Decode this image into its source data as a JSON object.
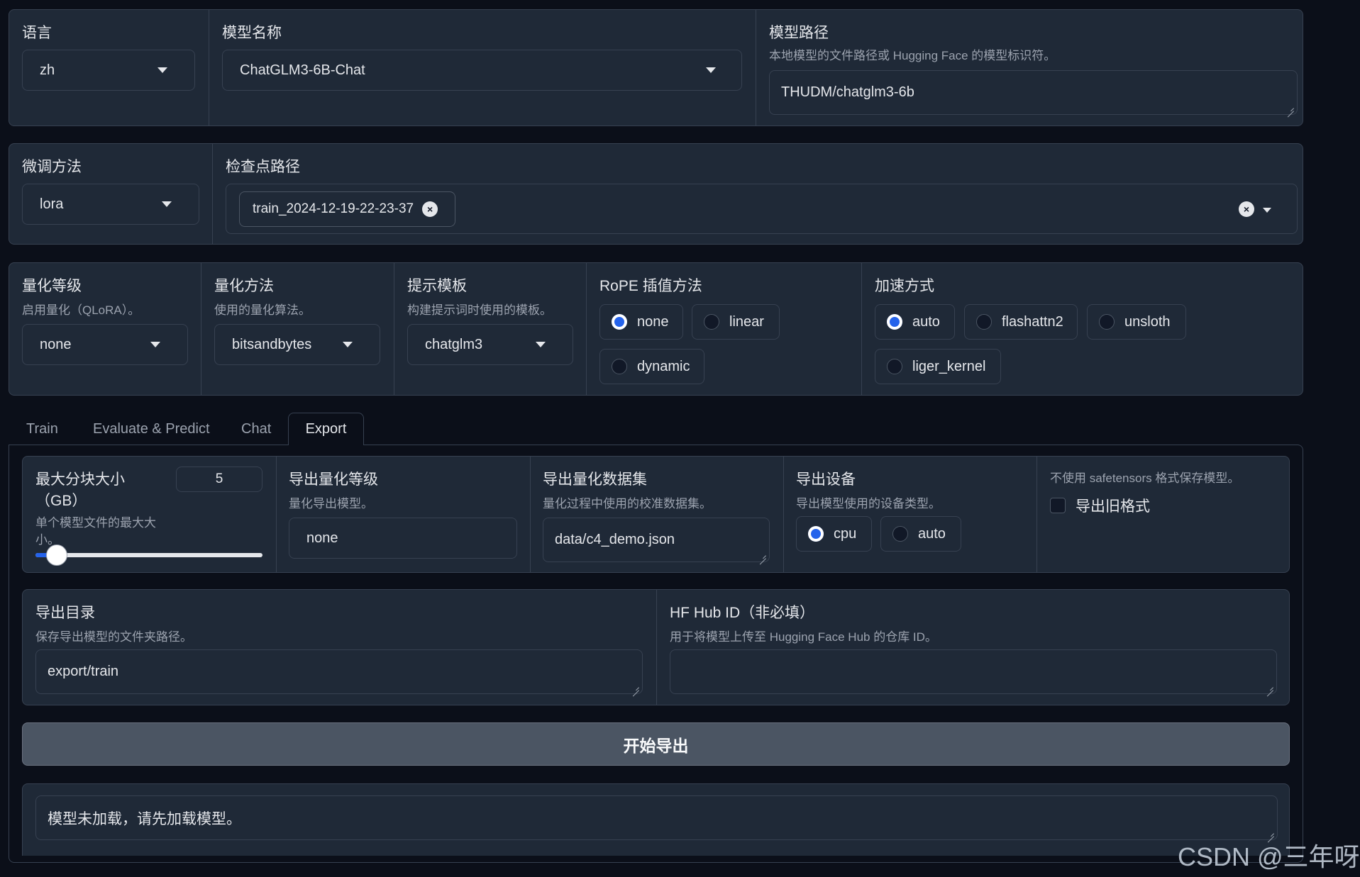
{
  "top": {
    "lang": {
      "label": "语言",
      "value": "zh"
    },
    "model_name": {
      "label": "模型名称",
      "value": "ChatGLM3-6B-Chat"
    },
    "model_path": {
      "label": "模型路径",
      "info": "本地模型的文件路径或 Hugging Face 的模型标识符。",
      "value": "THUDM/chatglm3-6b"
    }
  },
  "second": {
    "finetune": {
      "label": "微调方法",
      "value": "lora"
    },
    "checkpoint": {
      "label": "检查点路径",
      "chip": "train_2024-12-19-22-23-37"
    }
  },
  "third": {
    "quant_bit": {
      "label": "量化等级",
      "info": "启用量化（QLoRA）。",
      "value": "none"
    },
    "quant_method": {
      "label": "量化方法",
      "info": "使用的量化算法。",
      "value": "bitsandbytes"
    },
    "template": {
      "label": "提示模板",
      "info": "构建提示词时使用的模板。",
      "value": "chatglm3"
    },
    "rope": {
      "label": "RoPE 插值方法",
      "options": [
        "none",
        "linear",
        "dynamic"
      ],
      "selected": "none"
    },
    "booster": {
      "label": "加速方式",
      "options": [
        "auto",
        "flashattn2",
        "unsloth",
        "liger_kernel"
      ],
      "selected": "auto"
    }
  },
  "tabs": [
    "Train",
    "Evaluate & Predict",
    "Chat",
    "Export"
  ],
  "active_tab": "Export",
  "export": {
    "shard_size": {
      "label": "最大分块大小（GB）",
      "info": "单个模型文件的最大大小。",
      "value": "5",
      "slider_fraction": 0.05
    },
    "quant_bit": {
      "label": "导出量化等级",
      "info": "量化导出模型。",
      "value": "none"
    },
    "quant_dataset": {
      "label": "导出量化数据集",
      "info": "量化过程中使用的校准数据集。",
      "value": "data/c4_demo.json"
    },
    "device": {
      "label": "导出设备",
      "info": "导出模型使用的设备类型。",
      "options": [
        "cpu",
        "auto"
      ],
      "selected": "cpu"
    },
    "legacy": {
      "info": "不使用 safetensors 格式保存模型。",
      "label": "导出旧格式",
      "checked": false
    },
    "export_dir": {
      "label": "导出目录",
      "info": "保存导出模型的文件夹路径。",
      "value": "export/train"
    },
    "hub_id": {
      "label": "HF Hub ID（非必填）",
      "info": "用于将模型上传至 Hugging Face Hub 的仓库 ID。",
      "value": ""
    },
    "button": "开始导出",
    "output": "模型未加载，请先加载模型。"
  },
  "watermark": "CSDN @三年呀",
  "colors": {
    "accent": "#2563eb",
    "background": "#0b0f19",
    "panel": "#1f2937",
    "border": "#374151"
  }
}
